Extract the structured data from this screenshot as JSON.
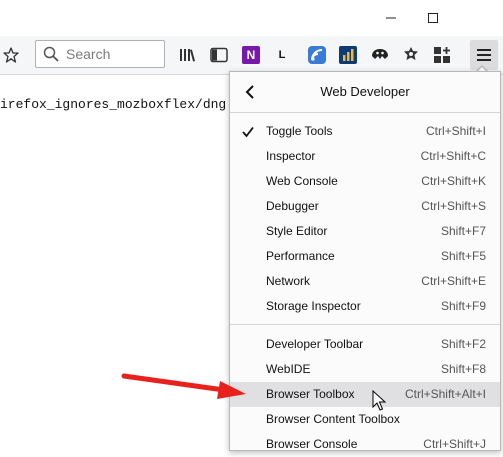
{
  "window": {
    "minimize_icon": "minimize-icon",
    "maximize_icon": "maximize-icon"
  },
  "toolbar": {
    "search": {
      "placeholder": "Search",
      "value": ""
    },
    "icons": [
      "bookmark-star-icon",
      "library-icon",
      "sidebar-icon",
      "onenote-icon",
      "lastpass-icon",
      "feedly-icon",
      "analytics-icon",
      "pocket-icon",
      "notifications-icon",
      "add-ons-icon",
      "menu-icon"
    ],
    "onenote_glyph": "N",
    "lastpass_glyph": "L"
  },
  "content": {
    "url_fragment": "irefox_ignores_mozboxflex/dng"
  },
  "panel": {
    "title": "Web Developer",
    "back_icon": "back-chevron-icon",
    "group1": [
      {
        "label": "Toggle Tools",
        "shortcut": "Ctrl+Shift+I",
        "checked": true
      },
      {
        "label": "Inspector",
        "shortcut": "Ctrl+Shift+C"
      },
      {
        "label": "Web Console",
        "shortcut": "Ctrl+Shift+K"
      },
      {
        "label": "Debugger",
        "shortcut": "Ctrl+Shift+S"
      },
      {
        "label": "Style Editor",
        "shortcut": "Shift+F7"
      },
      {
        "label": "Performance",
        "shortcut": "Shift+F5"
      },
      {
        "label": "Network",
        "shortcut": "Ctrl+Shift+E"
      },
      {
        "label": "Storage Inspector",
        "shortcut": "Shift+F9"
      }
    ],
    "group2": [
      {
        "label": "Developer Toolbar",
        "shortcut": "Shift+F2"
      },
      {
        "label": "WebIDE",
        "shortcut": "Shift+F8"
      },
      {
        "label": "Browser Toolbox",
        "shortcut": "Ctrl+Shift+Alt+I",
        "hovered": true
      },
      {
        "label": "Browser Content Toolbox",
        "shortcut": ""
      },
      {
        "label": "Browser Console",
        "shortcut": "Ctrl+Shift+J"
      }
    ]
  },
  "colors": {
    "annotation_arrow": "#e8211d",
    "hover_bg": "#e0e0e2",
    "toolbar_bg": "#f5f6f7"
  }
}
